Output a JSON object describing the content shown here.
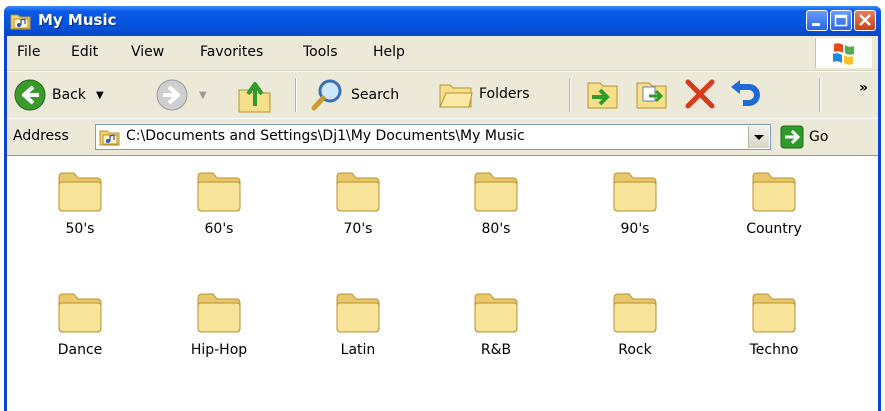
{
  "window": {
    "title": "My Music"
  },
  "menu": {
    "items": [
      "File",
      "Edit",
      "View",
      "Favorites",
      "Tools",
      "Help"
    ]
  },
  "toolbar": {
    "back_label": "Back",
    "search_label": "Search",
    "folders_label": "Folders",
    "overflow": "»"
  },
  "address": {
    "label": "Address",
    "path": "C:\\Documents and Settings\\Dj1\\My Documents\\My Music",
    "go_label": "Go"
  },
  "folders": [
    "50's",
    "60's",
    "70's",
    "80's",
    "90's",
    "Country",
    "Dance",
    "Hip-Hop",
    "Latin",
    "R&B",
    "Rock",
    "Techno"
  ],
  "colors": {
    "titlebar": "#0555e0",
    "chrome": "#ece9d8",
    "folder": "#f6df8a",
    "close": "#d83b1c",
    "back": "#3a9b2c"
  }
}
